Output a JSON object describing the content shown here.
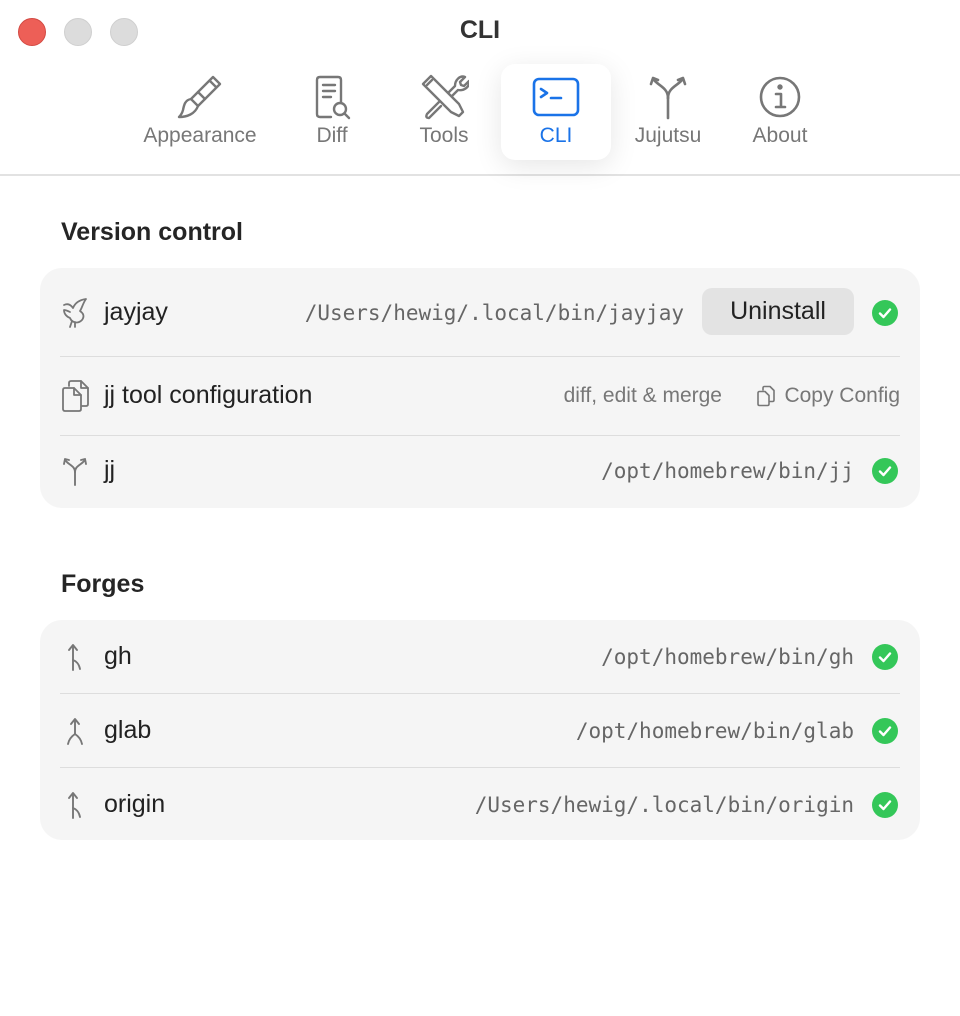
{
  "window": {
    "title": "CLI"
  },
  "tabs": [
    {
      "label": "Appearance",
      "icon": "paintbrush-icon"
    },
    {
      "label": "Diff",
      "icon": "doc-magnifier-icon"
    },
    {
      "label": "Tools",
      "icon": "wrench-screwdriver-icon"
    },
    {
      "label": "CLI",
      "icon": "terminal-icon",
      "active": true
    },
    {
      "label": "Jujutsu",
      "icon": "branch-icon"
    },
    {
      "label": "About",
      "icon": "info-circle-icon"
    }
  ],
  "version_control": {
    "title": "Version control",
    "jayjay": {
      "label": "jayjay",
      "path": "/Users/hewig/.local/bin/jayjay",
      "button": "Uninstall"
    },
    "config": {
      "label": "jj tool configuration",
      "description": "diff, edit & merge",
      "button": "Copy Config"
    },
    "jj": {
      "label": "jj",
      "path": "/opt/homebrew/bin/jj"
    }
  },
  "forges": {
    "title": "Forges",
    "items": [
      {
        "label": "gh",
        "path": "/opt/homebrew/bin/gh"
      },
      {
        "label": "glab",
        "path": "/opt/homebrew/bin/glab"
      },
      {
        "label": "origin",
        "path": "/Users/hewig/.local/bin/origin"
      }
    ]
  },
  "colors": {
    "accent": "#1a73e8",
    "success": "#34c759",
    "close": "#ed5f57"
  }
}
